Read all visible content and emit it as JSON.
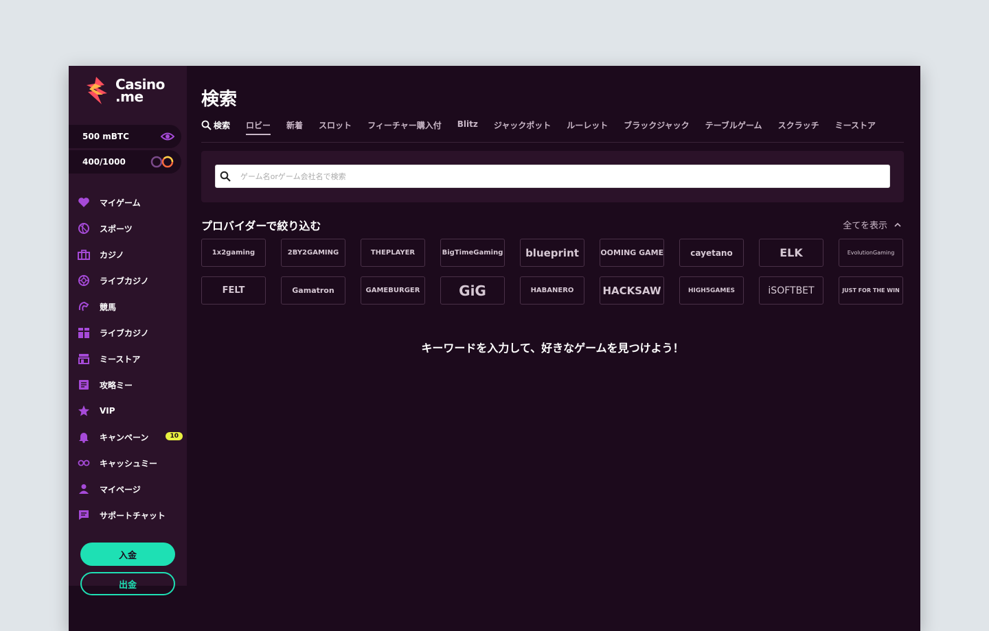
{
  "brand": {
    "line1": "Casino",
    "line2": ".me"
  },
  "wallet": {
    "balance": "500 mBTC",
    "cashme": "400/1000"
  },
  "nav": [
    {
      "label": "マイゲーム",
      "icon": "heart-icon"
    },
    {
      "label": "スポーツ",
      "icon": "sports-ball-icon"
    },
    {
      "label": "カジノ",
      "icon": "casino-icon"
    },
    {
      "label": "ライブカジノ",
      "icon": "roulette-icon"
    },
    {
      "label": "競馬",
      "icon": "horse-icon"
    },
    {
      "label": "ライブカジノ",
      "icon": "gift-icon"
    },
    {
      "label": "ミーストア",
      "icon": "store-icon"
    },
    {
      "label": "攻略ミー",
      "icon": "article-icon"
    },
    {
      "label": "VIP",
      "icon": "star-icon"
    },
    {
      "label": "キャンペーン",
      "icon": "bell-icon",
      "badge": "10"
    },
    {
      "label": "キャッシュミー",
      "icon": "infinity-icon"
    },
    {
      "label": "マイページ",
      "icon": "user-icon"
    },
    {
      "label": "サポートチャット",
      "icon": "chat-icon"
    }
  ],
  "buttons": {
    "deposit": "入金",
    "withdraw": "出金"
  },
  "page": {
    "title": "検索"
  },
  "tabs": [
    "検索",
    "ロビー",
    "新着",
    "スロット",
    "フィーチャー購入付",
    "Blitz",
    "ジャックポット",
    "ルーレット",
    "ブラックジャック",
    "テーブルゲーム",
    "スクラッチ",
    "ミーストア"
  ],
  "active_tab": "ロビー",
  "search": {
    "placeholder": "ゲーム名orゲーム会社名で検索",
    "value": ""
  },
  "filter": {
    "title": "プロバイダーで絞り込む",
    "show_all": "全てを表示"
  },
  "providers": [
    "1x2gaming",
    "2BY2GAMING",
    "THEPLAYER",
    "BigTimeGaming",
    "blueprint",
    "BOOMING GAMES",
    "cayetano",
    "ELK",
    "EvolutionGaming",
    "FELT",
    "Gamatron",
    "GAMEBURGER",
    "GiG",
    "HABANERO",
    "HACKSAW",
    "HIGH5GAMES",
    "iSOFTBET",
    "JUST FOR THE WIN"
  ],
  "empty_message": "キーワードを入力して、好きなゲームを見つけよう！",
  "colors": {
    "accent": "#1ee0b4",
    "brand_purple": "#9b3fc8",
    "badge": "#e8f040",
    "background": "#1c0a1c",
    "sidebar": "#2b1229"
  }
}
